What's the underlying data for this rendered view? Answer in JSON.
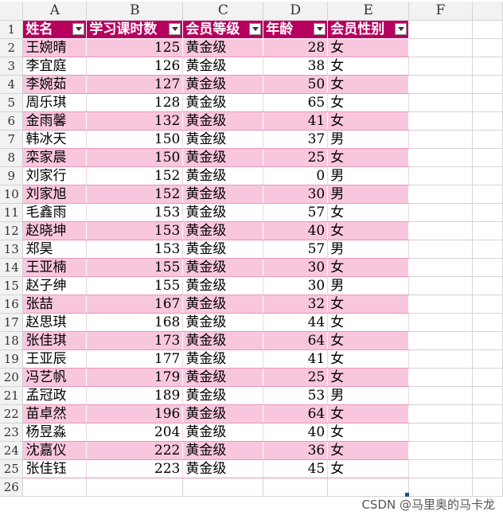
{
  "columns": [
    "A",
    "B",
    "C",
    "D",
    "E",
    "F"
  ],
  "headers": [
    "姓名",
    "学习课时数",
    "会员等级",
    "年龄",
    "会员性别"
  ],
  "rows": [
    [
      "王婉晴",
      "125",
      "黄金级",
      "28",
      "女"
    ],
    [
      "李宜庭",
      "126",
      "黄金级",
      "38",
      "女"
    ],
    [
      "李婉茹",
      "127",
      "黄金级",
      "50",
      "女"
    ],
    [
      "周乐琪",
      "128",
      "黄金级",
      "65",
      "女"
    ],
    [
      "金雨馨",
      "132",
      "黄金级",
      "41",
      "女"
    ],
    [
      "韩冰天",
      "150",
      "黄金级",
      "37",
      "男"
    ],
    [
      "栾家晨",
      "150",
      "黄金级",
      "25",
      "女"
    ],
    [
      "刘家行",
      "152",
      "黄金级",
      "0",
      "男"
    ],
    [
      "刘家旭",
      "152",
      "黄金级",
      "30",
      "男"
    ],
    [
      "毛鑫雨",
      "153",
      "黄金级",
      "57",
      "女"
    ],
    [
      "赵晓坤",
      "153",
      "黄金级",
      "40",
      "女"
    ],
    [
      "郑昊",
      "153",
      "黄金级",
      "57",
      "男"
    ],
    [
      "王亚楠",
      "155",
      "黄金级",
      "30",
      "女"
    ],
    [
      "赵子绅",
      "155",
      "黄金级",
      "30",
      "男"
    ],
    [
      "张喆",
      "167",
      "黄金级",
      "32",
      "女"
    ],
    [
      "赵思琪",
      "168",
      "黄金级",
      "44",
      "女"
    ],
    [
      "张佳琪",
      "173",
      "黄金级",
      "64",
      "女"
    ],
    [
      "王亚辰",
      "177",
      "黄金级",
      "41",
      "女"
    ],
    [
      "冯艺帆",
      "179",
      "黄金级",
      "25",
      "女"
    ],
    [
      "孟冠政",
      "189",
      "黄金级",
      "53",
      "男"
    ],
    [
      "苗卓然",
      "196",
      "黄金级",
      "64",
      "女"
    ],
    [
      "杨昱淼",
      "204",
      "黄金级",
      "40",
      "女"
    ],
    [
      "沈嘉仪",
      "222",
      "黄金级",
      "36",
      "女"
    ],
    [
      "张佳钰",
      "223",
      "黄金级",
      "45",
      "女"
    ]
  ],
  "row_numbers": [
    "1",
    "2",
    "3",
    "4",
    "5",
    "6",
    "7",
    "8",
    "9",
    "10",
    "11",
    "12",
    "13",
    "14",
    "15",
    "16",
    "17",
    "18",
    "19",
    "20",
    "21",
    "22",
    "23",
    "24",
    "25",
    "26"
  ],
  "watermark": "CSDN @马里奥的马卡龙",
  "colors": {
    "header_bg": "#b5005e",
    "band_bg": "#f9c7dd",
    "header_text": "#ffffff"
  }
}
